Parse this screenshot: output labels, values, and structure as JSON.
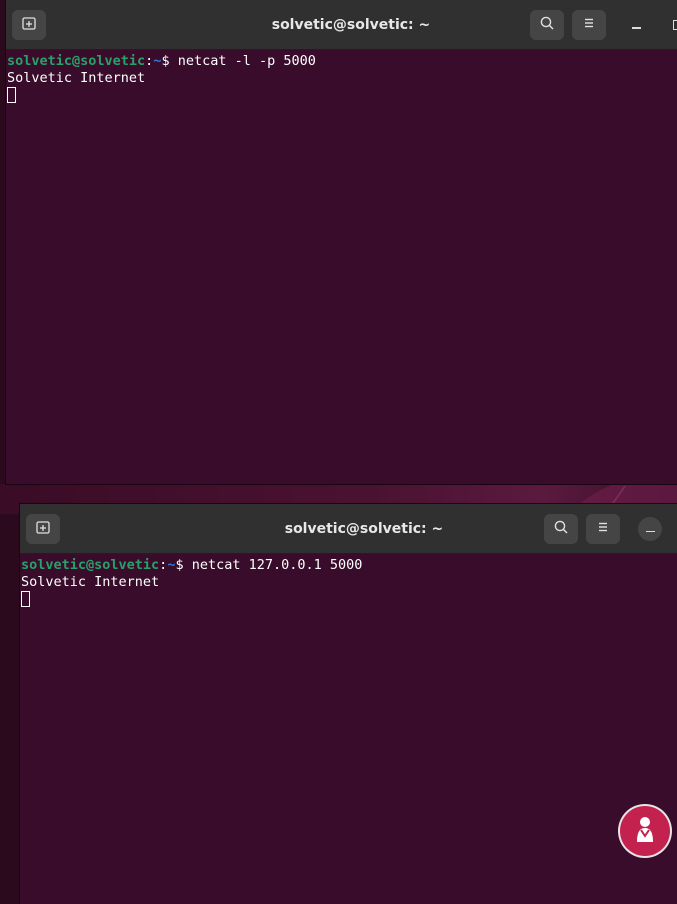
{
  "windows": [
    {
      "id": "top",
      "title": "solvetic@solvetic: ~",
      "prompt": {
        "user_host": "solvetic@solvetic",
        "colon": ":",
        "path": "~",
        "symbol": "$ "
      },
      "command": "netcat -l -p 5000",
      "output": [
        "Solvetic Internet"
      ],
      "buttons": {
        "new_tab": "new-tab-icon",
        "search": "search-icon",
        "menu": "hamburger-menu-icon",
        "minimize": "minimize-icon",
        "maximize": "maximize-icon"
      }
    },
    {
      "id": "bottom",
      "title": "solvetic@solvetic: ~",
      "prompt": {
        "user_host": "solvetic@solvetic",
        "colon": ":",
        "path": "~",
        "symbol": "$ "
      },
      "command": "netcat 127.0.0.1 5000",
      "output": [
        "Solvetic Internet"
      ],
      "buttons": {
        "new_tab": "new-tab-icon",
        "search": "search-icon",
        "menu": "hamburger-menu-icon",
        "minimize": "minimize-icon"
      }
    }
  ],
  "colors": {
    "terminal_bg": "#380c2a",
    "titlebar_bg": "#303030",
    "prompt_user": "#26a269",
    "prompt_path": "#2a7bde",
    "text": "#ffffff"
  },
  "watermark": {
    "brand": "solvetic",
    "icon": "person-logo-icon"
  }
}
